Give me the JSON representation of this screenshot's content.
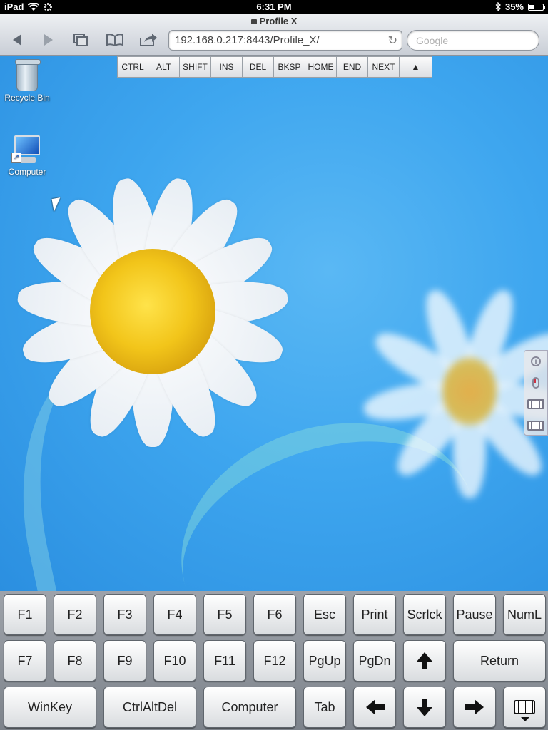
{
  "status_bar": {
    "device": "iPad",
    "time": "6:31 PM",
    "battery": "35%",
    "battery_level": 0.35
  },
  "browser": {
    "page_title": "Profile X",
    "url": "192.168.0.217:8443/Profile_X/",
    "search_placeholder": "Google"
  },
  "desktop": {
    "icons": [
      {
        "label": "Recycle Bin",
        "icon": "recycle-bin-icon"
      },
      {
        "label": "Computer",
        "icon": "computer-icon"
      }
    ]
  },
  "key_toolbar": {
    "keys": [
      "CTRL",
      "ALT",
      "SHIFT",
      "INS",
      "DEL",
      "BKSP",
      "HOME",
      "END",
      "NEXT"
    ],
    "toggle_icon": "▲"
  },
  "side_tools": {
    "items": [
      "info-icon",
      "mouse-icon",
      "keyboard-icon",
      "keyboard-alt-icon"
    ]
  },
  "virtual_keyboard": {
    "row1": [
      "F1",
      "F2",
      "F3",
      "F4",
      "F5",
      "F6",
      "Esc",
      "Print",
      "Scrlck",
      "Pause",
      "NumL"
    ],
    "row2": [
      "F7",
      "F8",
      "F9",
      "F10",
      "F11",
      "F12",
      "PgUp",
      "PgDn"
    ],
    "row2_return": "Return",
    "row3": [
      "WinKey",
      "CtrlAltDel",
      "Computer",
      "Tab"
    ]
  }
}
